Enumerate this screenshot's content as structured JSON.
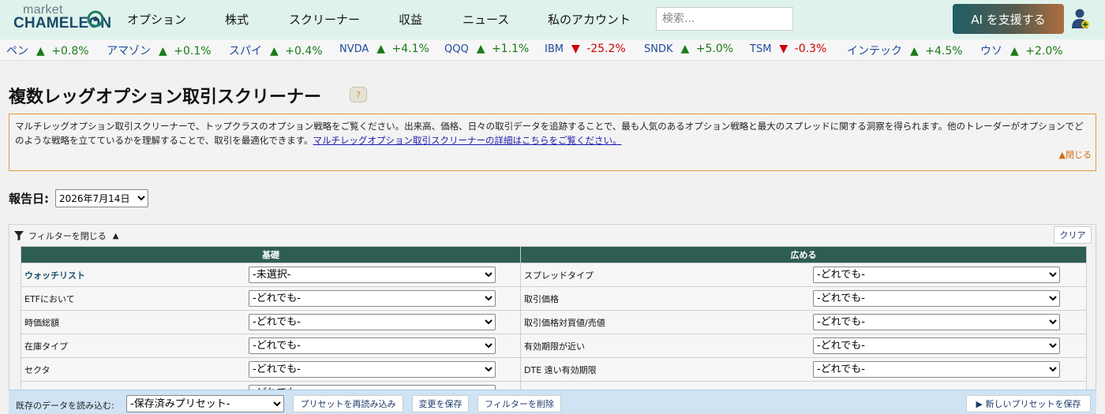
{
  "header": {
    "logo_top": "market",
    "logo_name": "CHAMELEON",
    "nav": [
      "オプション",
      "株式",
      "スクリーナー",
      "収益",
      "ニュース",
      "私のアカウント"
    ],
    "search_placeholder": "検索...",
    "ai_button": "AI を支援する"
  },
  "ticker": [
    {
      "name": "ペン",
      "arrow": "▲",
      "change": "+0.8%",
      "dir": "up"
    },
    {
      "name": "アマゾン",
      "arrow": "▲",
      "change": "+0.1%",
      "dir": "up"
    },
    {
      "name": "スパイ",
      "arrow": "▲",
      "change": "+0.4%",
      "dir": "up"
    },
    {
      "name": "NVDA",
      "arrow": "▲",
      "change": "+4.1%",
      "dir": "up"
    },
    {
      "name": "QQQ",
      "arrow": "▲",
      "change": "+1.1%",
      "dir": "up"
    },
    {
      "name": "IBM",
      "arrow": "▼",
      "change": "-25.2%",
      "dir": "down"
    },
    {
      "name": "SNDK",
      "arrow": "▲",
      "change": "+5.0%",
      "dir": "up"
    },
    {
      "name": "TSM",
      "arrow": "▼",
      "change": "-0.3%",
      "dir": "down"
    },
    {
      "name": "インテック",
      "arrow": "▲",
      "change": "+4.5%",
      "dir": "up"
    },
    {
      "name": "ウソ",
      "arrow": "▲",
      "change": "+2.0%",
      "dir": "up"
    }
  ],
  "page": {
    "title": "複数レッグオプション取引スクリーナー",
    "help": "?",
    "description": "マルチレッグオプション取引スクリーナーで、トップクラスのオプション戦略をご覧ください。出来高、価格、日々の取引データを追跡することで、最も人気のあるオプション戦略と最大のスプレッドに関する洞察を得られます。他のトレーダーがオプションでどのような戦略を立てているかを理解することで、取引を最適化できます。",
    "description_link": "マルチレッグオプション取引スクリーナーの詳細はこちらをご覧ください。",
    "close": "▲閉じる",
    "report_date_label": "報告日:",
    "report_date": "2026年7月14日"
  },
  "filters": {
    "toggle_label": "フィルターを閉じる",
    "clear": "クリア",
    "left_header": "基礎",
    "right_header": "広める",
    "left": [
      {
        "label": "ウォッチリスト",
        "value": "-未選択-"
      },
      {
        "label": "ETFにおいて",
        "value": "-どれでも-"
      },
      {
        "label": "時価総額",
        "value": "-どれでも-"
      },
      {
        "label": "在庫タイプ",
        "value": "-どれでも-"
      },
      {
        "label": "セクタ",
        "value": "-どれでも-"
      },
      {
        "label": "",
        "value": "-どれでも-"
      }
    ],
    "right": [
      {
        "label": "スプレッドタイプ",
        "value": "-どれでも-"
      },
      {
        "label": "取引価格",
        "value": "-どれでも-"
      },
      {
        "label": "取引価格対買値/売値",
        "value": "-どれでも-"
      },
      {
        "label": "有効期限が近い",
        "value": "-どれでも-"
      },
      {
        "label": "DTE 遠い有効期限",
        "value": "-どれでも-"
      }
    ]
  },
  "presets": {
    "load_label": "既存のデータを読み込む:",
    "select": "-保存済みプリセット-",
    "reload": "プリセットを再読み込み",
    "save_changes": "変更を保存",
    "delete_filter": "フィルターを削除",
    "save_new": "▶ 新しいプリセットを保存"
  },
  "colors": {
    "header_bg": "#dff3ec",
    "table_header": "#2e5d52",
    "up": "#1a7a1a",
    "down": "#d00000",
    "desc_border": "#e59a3a"
  }
}
